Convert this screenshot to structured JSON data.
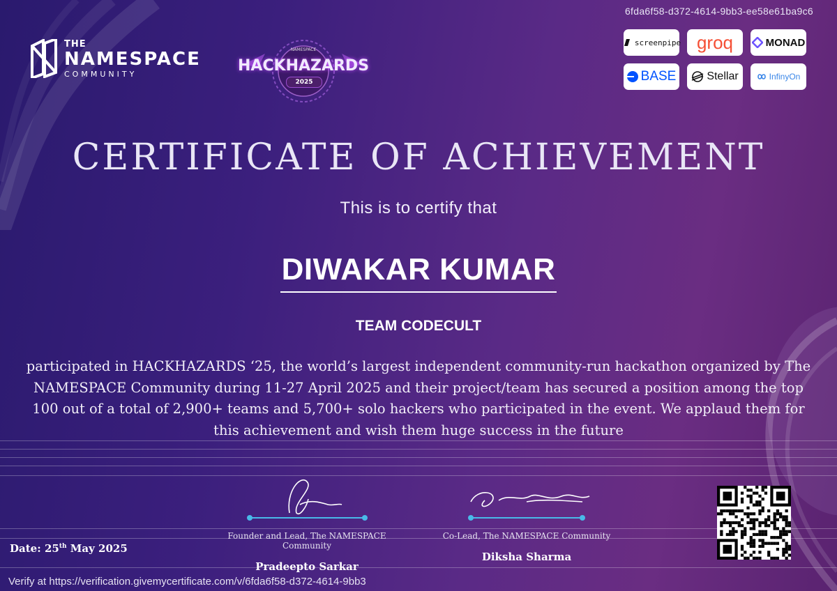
{
  "certificate_id": "6fda6f58-d372-4614-9bb3-ee58e61ba9c6",
  "org_logo": {
    "line1": "THE",
    "line2": "NAMESPACE",
    "line3": "COMMUNITY"
  },
  "event_logo": {
    "top": "NAMESPACE",
    "title": "HACKHAZARDS",
    "year": "2025"
  },
  "sponsors": [
    {
      "label": "screenpipe",
      "icon": "screenpipe-icon"
    },
    {
      "label": "groq",
      "icon": "none",
      "color": "#f55036"
    },
    {
      "label": "MONAD",
      "icon": "monad-icon"
    },
    {
      "label": "BASE",
      "icon": "base-icon",
      "color": "#0052ff"
    },
    {
      "label": "Stellar",
      "icon": "stellar-icon"
    },
    {
      "label": "InfinyOn",
      "icon": "infinyon-icon",
      "color": "#3a86e8"
    }
  ],
  "title": "CERTIFICATE OF ACHIEVEMENT",
  "subtitle": "This is to certify that",
  "recipient": "DIWAKAR KUMAR",
  "team": "TEAM CODECULT",
  "body_text": "participated in HACKHAZARDS ‘25, the world’s largest independent community-run hackathon organized by The NAMESPACE Community during 11-27 April 2025 and their project/team has secured a position among the top 100 out of a total of 2,900+ teams and 5,700+ solo hackers who participated in the event. We applaud them for this achievement and wish them huge success in the future",
  "signatories": [
    {
      "role": "Founder and Lead, The NAMESPACE Community",
      "name": "Pradeepto Sarkar"
    },
    {
      "role": "Co-Lead, The NAMESPACE Community",
      "name": "Diksha Sharma"
    }
  ],
  "date": {
    "prefix": "Date: 25",
    "suffix": "th",
    "rest": " May 2025"
  },
  "verify_text": "Verify at https://verification.givemycertificate.com/v/6fda6f58-d372-4614-9bb3",
  "colors": {
    "background": "#3b1f7d",
    "accent_line": "#49b9e8"
  }
}
